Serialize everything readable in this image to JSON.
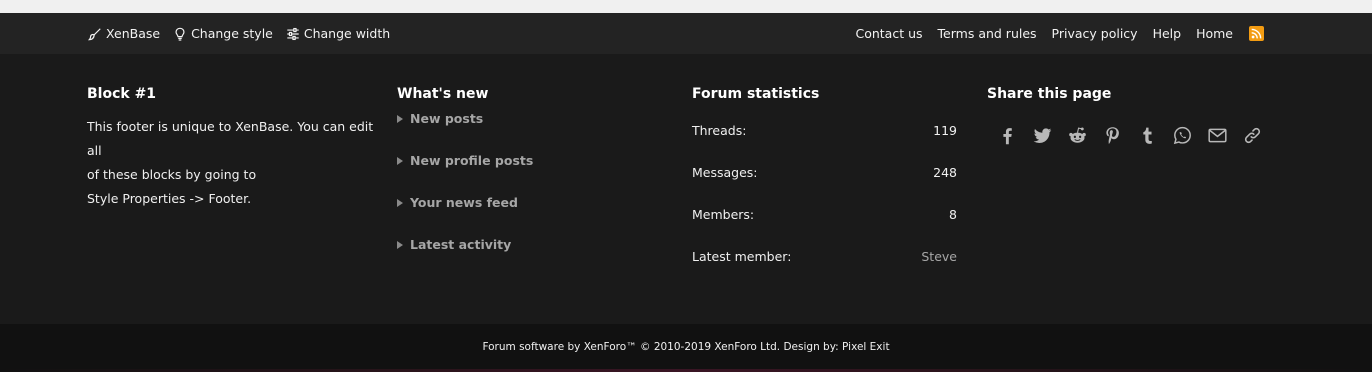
{
  "footer_nav": {
    "left": [
      {
        "icon": "brush-icon",
        "label": "XenBase"
      },
      {
        "icon": "lightbulb-icon",
        "label": "Change style"
      },
      {
        "icon": "sliders-icon",
        "label": "Change width"
      }
    ],
    "right": [
      "Contact us",
      "Terms and rules",
      "Privacy policy",
      "Help",
      "Home"
    ],
    "rss_icon": "rss-icon"
  },
  "block1": {
    "title": "Block #1",
    "line1": "This footer is unique to XenBase. You can edit all",
    "line2": "of these blocks by going to",
    "line3": "Style Properties -> Footer."
  },
  "whats_new": {
    "title": "What's new",
    "items": [
      "New posts",
      "New profile posts",
      "Your news feed",
      "Latest activity"
    ]
  },
  "stats": {
    "title": "Forum statistics",
    "rows": [
      {
        "label": "Threads:",
        "value": "119"
      },
      {
        "label": "Messages:",
        "value": "248"
      },
      {
        "label": "Members:",
        "value": "8"
      },
      {
        "label": "Latest member:",
        "value": "Steve"
      }
    ]
  },
  "share": {
    "title": "Share this page",
    "icons": [
      "facebook-icon",
      "twitter-icon",
      "reddit-icon",
      "pinterest-icon",
      "tumblr-icon",
      "whatsapp-icon",
      "email-icon",
      "link-icon"
    ]
  },
  "copyright": "Forum software by XenForo™ © 2010-2019 XenForo Ltd. Design by: Pixel Exit",
  "colors": {
    "nav_bg": "#232323",
    "block_bg": "#1a1a1a",
    "copyright_bg": "#111111",
    "muted_link": "#a6a6a6",
    "rss": "#f39c12"
  }
}
